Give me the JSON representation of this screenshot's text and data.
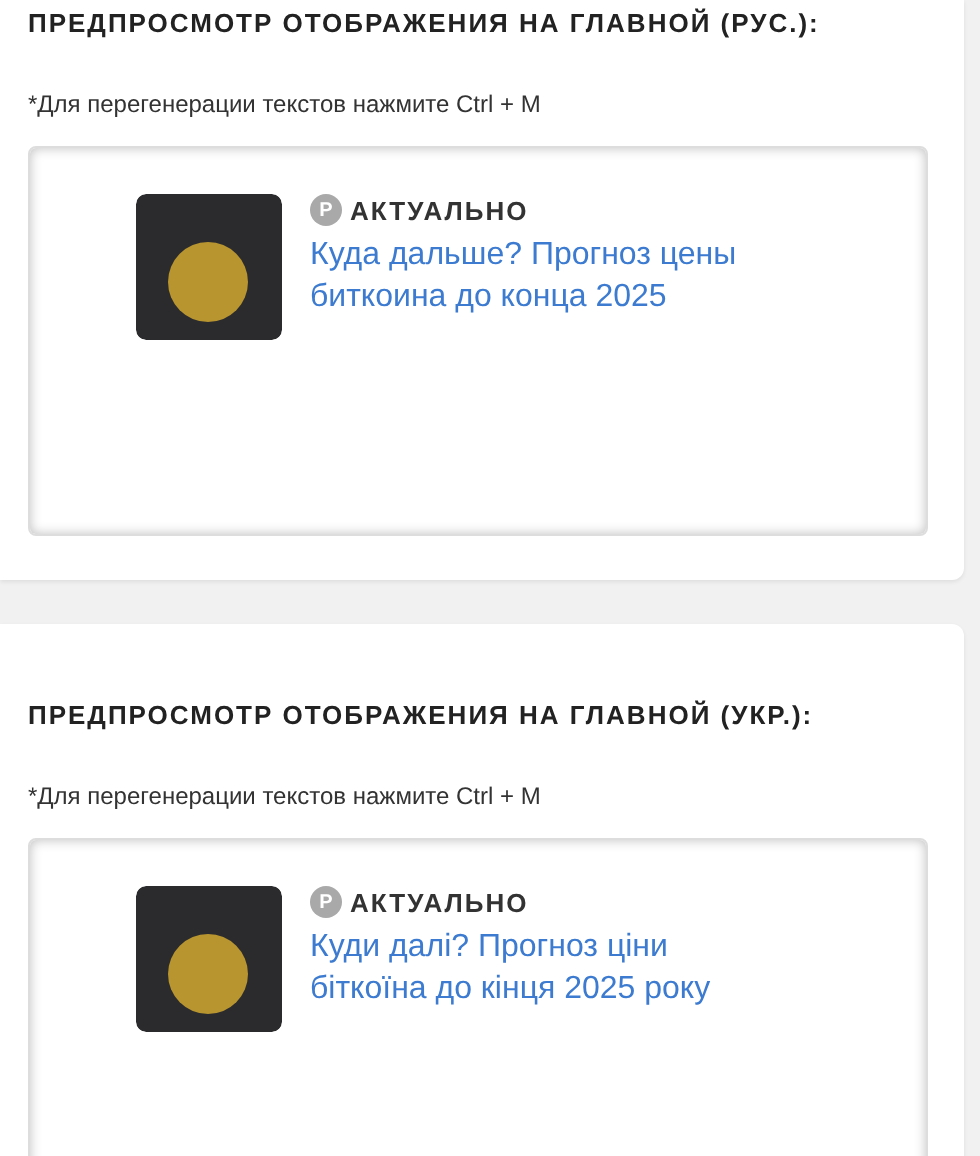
{
  "sections": [
    {
      "heading": "ПРЕДПРОСМОТР ОТОБРАЖЕНИЯ НА ГЛАВНОЙ (РУС.):",
      "note": "*Для перегенерации текстов нажмите Ctrl + M",
      "preview": {
        "badge": "Р",
        "tag": "АКТУАЛЬНО",
        "title": "Куда дальше? Прогноз цены биткоина до конца 2025"
      }
    },
    {
      "heading": "ПРЕДПРОСМОТР ОТОБРАЖЕНИЯ НА ГЛАВНОЙ (УКР.):",
      "note": "*Для перегенерации текстов нажмите Ctrl + M",
      "preview": {
        "badge": "Р",
        "tag": "АКТУАЛЬНО",
        "title": "Куди далі? Прогноз ціни біткоїна до кінця 2025 року"
      }
    }
  ]
}
